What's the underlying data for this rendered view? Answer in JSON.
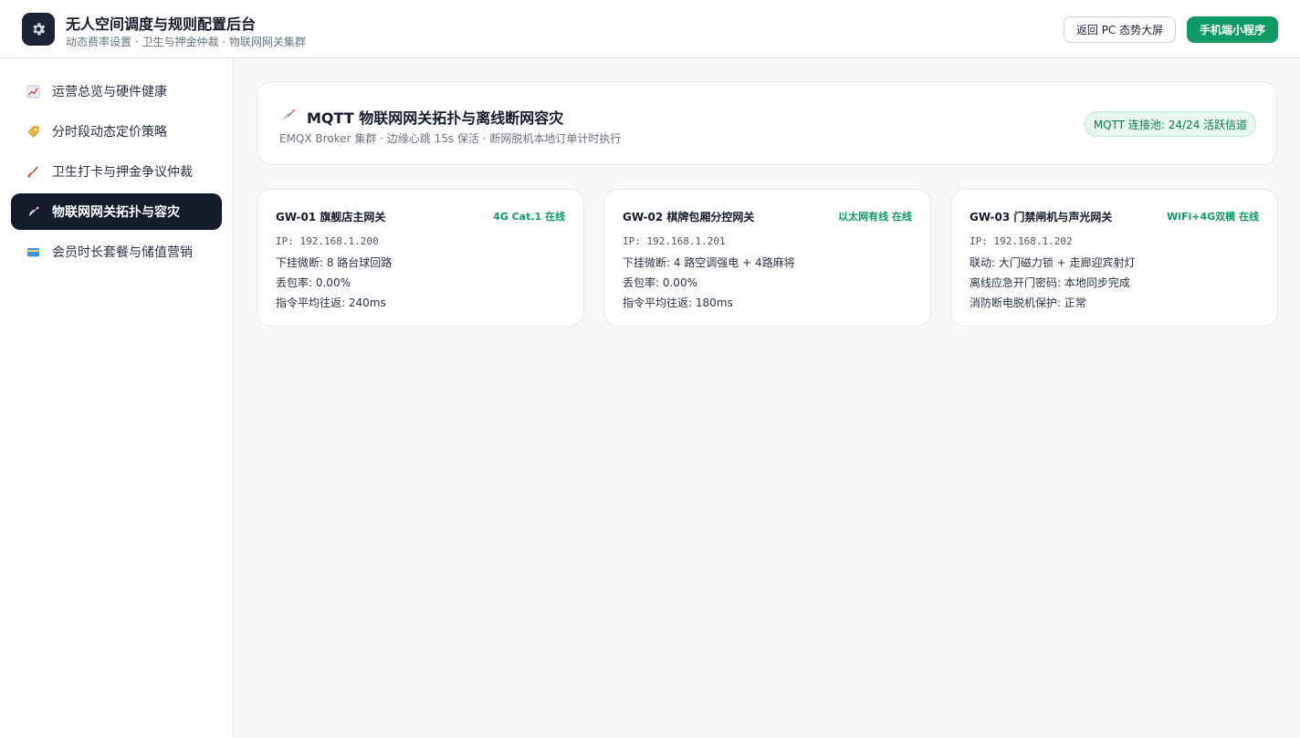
{
  "header": {
    "title": "无人空间调度与规则配置后台",
    "subtitle": "动态费率设置 · 卫生与押金仲裁 · 物联网网关集群",
    "btn_back": "返回 PC 态势大屏",
    "btn_mobile": "手机端小程序",
    "logo_icon": "gear-icon"
  },
  "sidebar": {
    "items": [
      {
        "label": "运营总览与硬件健康",
        "icon": "chart-icon",
        "active": false
      },
      {
        "label": "分时段动态定价策略",
        "icon": "tag-icon",
        "active": false
      },
      {
        "label": "卫生打卡与押金争议仲裁",
        "icon": "broom-icon",
        "active": false
      },
      {
        "label": "物联网网关拓扑与容灾",
        "icon": "satellite-icon",
        "active": true
      },
      {
        "label": "会员时长套餐与储值营销",
        "icon": "card-icon",
        "active": false
      }
    ]
  },
  "main": {
    "title": "MQTT 物联网网关拓扑与离线断网容灾",
    "subtitle": "EMQX Broker 集群 · 边缘心跳 15s 保活 · 断网脱机本地订单计时执行",
    "pool_badge": "MQTT 连接池: 24/24 活跃信道",
    "icon": "satellite-icon"
  },
  "gateways": [
    {
      "name": "GW-01 旗舰店主网关",
      "status": "4G Cat.1 在线",
      "ip": "IP: 192.168.1.200",
      "line2": "下挂微断: 8 路台球回路",
      "line3": "丢包率: 0.00%",
      "line4": "指令平均往返: 240ms"
    },
    {
      "name": "GW-02 棋牌包厢分控网关",
      "status": "以太网有线 在线",
      "ip": "IP: 192.168.1.201",
      "line2": "下挂微断: 4 路空调强电 + 4路麻将",
      "line3": "丢包率: 0.00%",
      "line4": "指令平均往返: 180ms"
    },
    {
      "name": "GW-03 门禁闸机与声光网关",
      "status": "WiFi+4G双模 在线",
      "ip": "IP: 192.168.1.202",
      "line2": "联动: 大门磁力锁 + 走廊迎宾射灯",
      "line3": "离线应急开门密码: 本地同步完成",
      "line4": "消防断电脱机保护: 正常"
    }
  ],
  "colors": {
    "accent_green": "#0e9a62",
    "active_nav": "#141b2b"
  }
}
